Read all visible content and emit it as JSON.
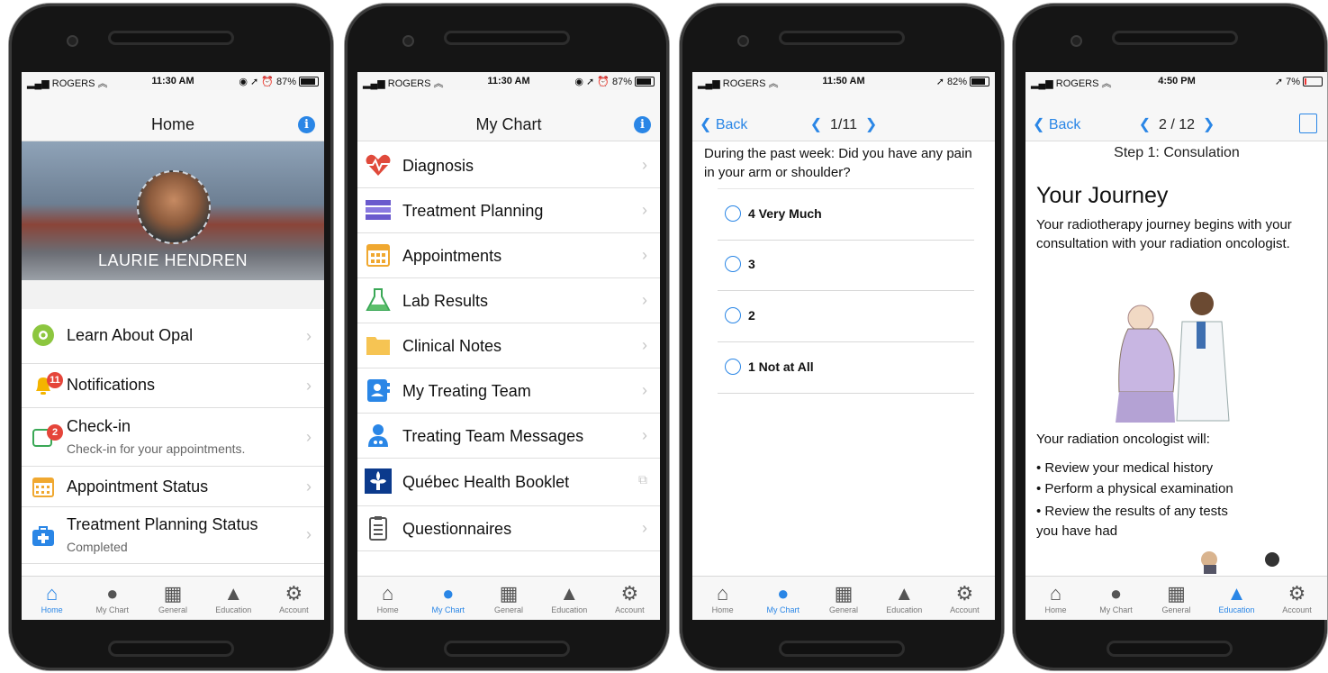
{
  "tabs": [
    "Home",
    "My Chart",
    "General",
    "Education",
    "Account"
  ],
  "status": {
    "carrier": "ROGERS"
  },
  "phone1": {
    "time": "11:30 AM",
    "battery": "87%",
    "title": "Home",
    "user_name": "LAURIE HENDREN",
    "items": [
      {
        "label": "Learn About Opal"
      },
      {
        "label": "Notifications",
        "badge": "11"
      },
      {
        "label": "Check-in",
        "sub": "Check-in for your appointments.",
        "badge": "2"
      },
      {
        "label": "Appointment Status"
      },
      {
        "label": "Treatment Planning Status",
        "sub": "Completed"
      }
    ]
  },
  "phone2": {
    "time": "11:30 AM",
    "battery": "87%",
    "title": "My Chart",
    "items": [
      {
        "label": "Diagnosis"
      },
      {
        "label": "Treatment Planning"
      },
      {
        "label": "Appointments"
      },
      {
        "label": "Lab Results"
      },
      {
        "label": "Clinical Notes"
      },
      {
        "label": "My Treating Team"
      },
      {
        "label": "Treating Team Messages"
      },
      {
        "label": "Québec Health Booklet"
      },
      {
        "label": "Questionnaires"
      }
    ]
  },
  "phone3": {
    "time": "11:50 AM",
    "battery": "82%",
    "back": "Back",
    "page": "1/11",
    "question": "During the past week: Did you have any pain in your arm or shoulder?",
    "options": [
      {
        "label": "4  Very Much"
      },
      {
        "label": "3"
      },
      {
        "label": "2"
      },
      {
        "label": "1  Not at All"
      }
    ]
  },
  "phone4": {
    "time": "4:50 PM",
    "battery": "7%",
    "back": "Back",
    "page": "2 / 12",
    "step": "Step 1: Consulation",
    "heading": "Your Journey",
    "intro": "Your radiotherapy journey begins with your consultation with your radiation oncologist.",
    "will": "Your radiation oncologist will:",
    "bullets": [
      "• Review your medical history",
      "• Perform a physical examination",
      "• Review the results of any tests you have had"
    ]
  },
  "colors": {
    "accent": "#2a86e6",
    "badge": "#e5453a"
  }
}
